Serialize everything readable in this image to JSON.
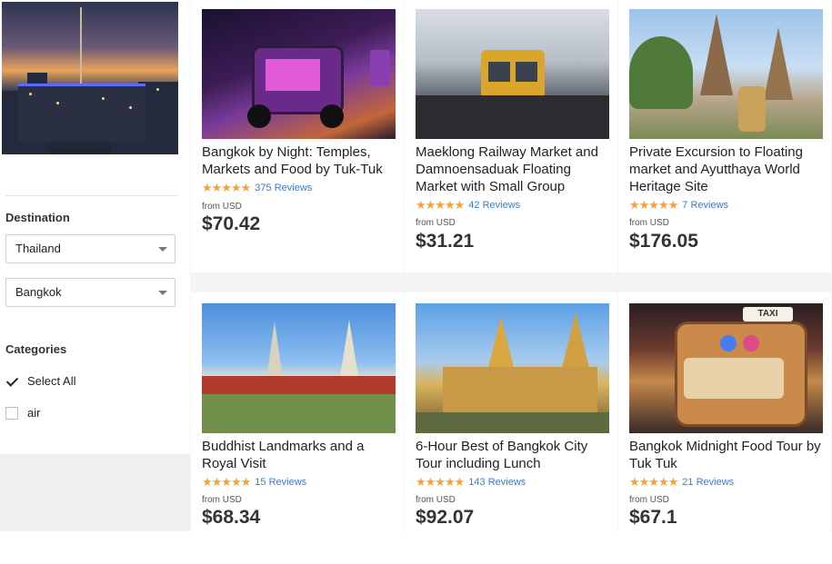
{
  "sidebar": {
    "destination_label": "Destination",
    "country_select": "Thailand",
    "city_select": "Bangkok",
    "categories_label": "Categories",
    "categories": [
      {
        "label": "Select All",
        "checked": true
      },
      {
        "label": "air",
        "checked": false
      }
    ]
  },
  "tours": [
    {
      "title": "Bangkok by Night: Temples, Markets and Food by Tuk-Tuk",
      "reviews": "375 Reviews",
      "from": "from USD",
      "price": "$70.42",
      "stars": "★★★★★"
    },
    {
      "title": "Maeklong Railway Market and Damnoensaduak Floating Market with Small Group",
      "reviews": "42 Reviews",
      "from": "from USD",
      "price": "$31.21",
      "stars": "★★★★★"
    },
    {
      "title": "Private Excursion to Floating market and Ayutthaya World Heritage Site",
      "reviews": "7 Reviews",
      "from": "from USD",
      "price": "$176.05",
      "stars": "★★★★★"
    },
    {
      "title": "Buddhist Landmarks and a Royal Visit",
      "reviews": "15 Reviews",
      "from": "from USD",
      "price": "$68.34",
      "stars": "★★★★★"
    },
    {
      "title": "6-Hour Best of Bangkok City Tour including Lunch",
      "reviews": "143 Reviews",
      "from": "from USD",
      "price": "$92.07",
      "stars": "★★★★★"
    },
    {
      "title": "Bangkok Midnight Food Tour by Tuk Tuk",
      "reviews": "21 Reviews",
      "from": "from USD",
      "price": "$67.1",
      "stars": "★★★★★"
    }
  ],
  "photo_sign": "TAXI"
}
